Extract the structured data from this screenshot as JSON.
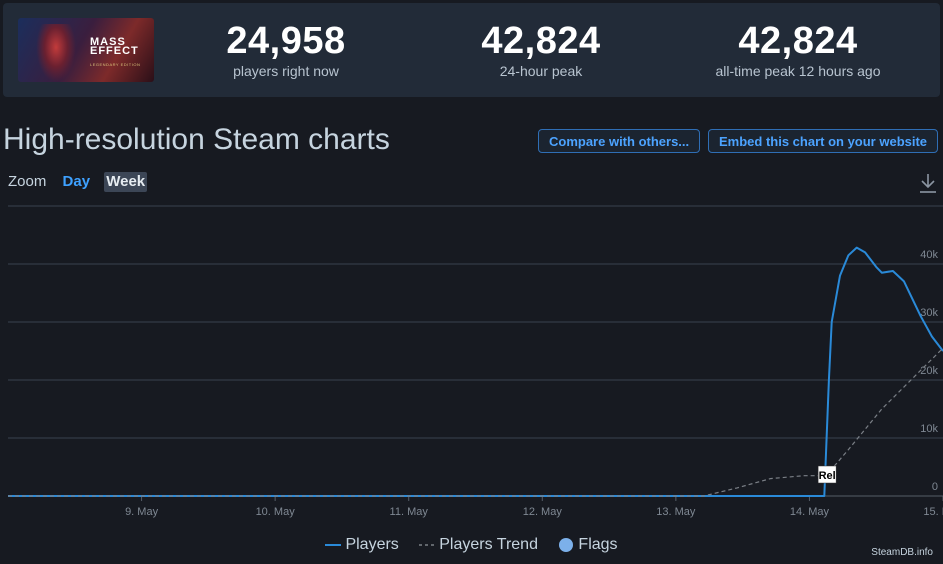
{
  "stats": [
    {
      "value": "24,958",
      "label": "players right now"
    },
    {
      "value": "42,824",
      "label": "24-hour peak"
    },
    {
      "value": "42,824",
      "label": "all-time peak 12 hours ago"
    }
  ],
  "logo": {
    "text": "MASS EFFECT",
    "subtext": "LEGENDARY EDITION"
  },
  "page_title": "High-resolution Steam charts",
  "buttons": {
    "compare": "Compare with others...",
    "embed": "Embed this chart on your website"
  },
  "zoom": {
    "label": "Zoom",
    "options": [
      "Day",
      "Week"
    ],
    "active": "Week"
  },
  "icons": {
    "download": "download-icon"
  },
  "colors": {
    "players": "#2a8ad8",
    "trend": "#7a7f86",
    "flags": "#7cb0ea",
    "accent": "#3ea1ff"
  },
  "chart_data": {
    "type": "line",
    "x_ticks": [
      "9. May",
      "10. May",
      "11. May",
      "12. May",
      "13. May",
      "14. May",
      "15. May"
    ],
    "y_ticks": [
      "0",
      "10k",
      "20k",
      "30k",
      "40k"
    ],
    "ylim": [
      0,
      50000
    ],
    "xlim": [
      "2021-05-08 12:00",
      "2021-05-15 12:00"
    ],
    "grid": true,
    "legend": {
      "position": "bottom",
      "entries": [
        "Players",
        "Players Trend",
        "Flags"
      ]
    },
    "series": [
      {
        "name": "Players",
        "style": "solid",
        "points": [
          [
            "2021-05-08 12:00",
            0
          ],
          [
            "2021-05-14 14:00",
            0
          ],
          [
            "2021-05-14 14:40",
            0
          ],
          [
            "2021-05-14 15:30",
            20000
          ],
          [
            "2021-05-14 16:00",
            30000
          ],
          [
            "2021-05-14 17:30",
            38000
          ],
          [
            "2021-05-14 19:00",
            41500
          ],
          [
            "2021-05-14 20:30",
            42824
          ],
          [
            "2021-05-14 22:00",
            42000
          ],
          [
            "2021-05-15 00:00",
            39500
          ],
          [
            "2021-05-15 01:00",
            38500
          ],
          [
            "2021-05-15 03:00",
            38800
          ],
          [
            "2021-05-15 05:00",
            37000
          ],
          [
            "2021-05-15 08:00",
            31000
          ],
          [
            "2021-05-15 10:00",
            27500
          ],
          [
            "2021-05-15 12:00",
            25000
          ]
        ]
      },
      {
        "name": "Players Trend",
        "style": "dashed",
        "points": [
          [
            "2021-05-08 12:00",
            0
          ],
          [
            "2021-05-13 17:00",
            0
          ],
          [
            "2021-05-13 23:00",
            1400
          ],
          [
            "2021-05-14 05:00",
            3000
          ],
          [
            "2021-05-14 11:00",
            3500
          ],
          [
            "2021-05-14 15:00",
            3500
          ],
          [
            "2021-05-14 19:00",
            8000
          ],
          [
            "2021-05-15 01:00",
            15000
          ],
          [
            "2021-05-15 12:00",
            25500
          ]
        ]
      }
    ],
    "flags": [
      {
        "label": "Rel",
        "x": "2021-05-14 15:00"
      }
    ]
  },
  "credit": "SteamDB.info"
}
